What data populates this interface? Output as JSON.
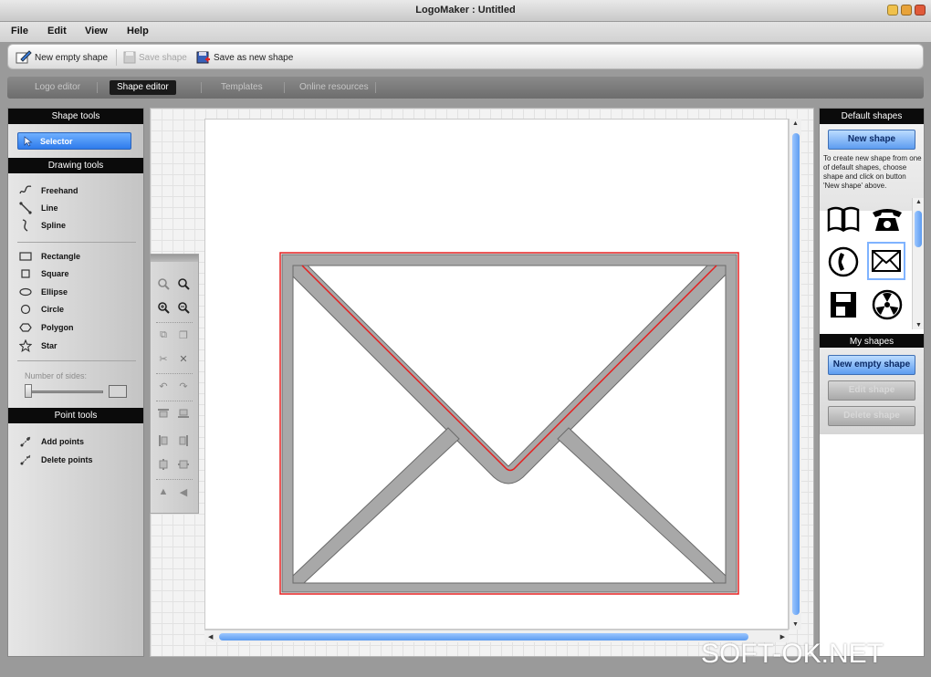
{
  "window": {
    "title": "LogoMaker : Untitled"
  },
  "menu": [
    "File",
    "Edit",
    "View",
    "Help"
  ],
  "toolbar": {
    "new_empty_shape": "New empty shape",
    "save_shape": "Save shape",
    "save_as_new_shape": "Save as new shape"
  },
  "tabs": [
    {
      "label": "Logo editor",
      "active": false
    },
    {
      "label": "Shape editor",
      "active": true
    },
    {
      "label": "Templates",
      "active": false
    },
    {
      "label": "Online resources",
      "active": false
    }
  ],
  "left_panel": {
    "shape_tools_header": "Shape tools",
    "selector_label": "Selector",
    "drawing_tools_header": "Drawing tools",
    "drawing_tools": [
      {
        "label": "Freehand",
        "icon": "freehand-icon"
      },
      {
        "label": "Line",
        "icon": "line-icon"
      },
      {
        "label": "Spline",
        "icon": "spline-icon"
      }
    ],
    "shape_tools": [
      {
        "label": "Rectangle",
        "icon": "rectangle-icon"
      },
      {
        "label": "Square",
        "icon": "square-icon"
      },
      {
        "label": "Ellipse",
        "icon": "ellipse-icon"
      },
      {
        "label": "Circle",
        "icon": "circle-icon"
      },
      {
        "label": "Polygon",
        "icon": "polygon-icon"
      },
      {
        "label": "Star",
        "icon": "star-icon"
      }
    ],
    "number_of_sides_label": "Number of sides:",
    "point_tools_header": "Point tools",
    "point_tools": [
      {
        "label": "Add points",
        "icon": "add-points-icon"
      },
      {
        "label": "Delete points",
        "icon": "delete-points-icon"
      }
    ]
  },
  "right_panel": {
    "default_shapes_header": "Default shapes",
    "new_shape_button": "New shape",
    "hint": "To create new shape from one of default shapes, choose shape and click on button 'New shape' above.",
    "default_shapes": [
      "book-icon",
      "telephone-icon",
      "phone-handset-icon",
      "envelope-icon",
      "floppy-disk-icon",
      "radiation-icon"
    ],
    "my_shapes_header": "My shapes",
    "new_empty_shape_button": "New empty shape",
    "edit_shape_button": "Edit shape",
    "delete_shape_button": "Delete shape"
  },
  "watermark": "SOFT-OK.NET",
  "colors": {
    "accent_blue": "#2e7bec",
    "selection_red": "#e52020",
    "shape_grey": "#a8a8a8"
  }
}
